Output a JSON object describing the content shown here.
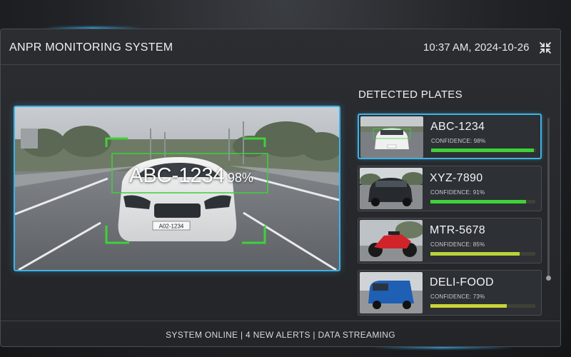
{
  "header": {
    "title": "ANPR MONITORING SYSTEM",
    "datetime": "10:37 AM, 2024-10-26",
    "collapse_icon": "collapse-arrows-icon"
  },
  "feed": {
    "plate": "ABC-1234",
    "confidence": "98%",
    "car_plate_text": "A02-1234"
  },
  "detected": {
    "title": "DETECTED PLATES",
    "items": [
      {
        "plate": "ABC-1234",
        "confidence_label": "CONFIDENCE: 98%",
        "confidence": 0.98,
        "bar_color": "#3fd13a",
        "vehicle": "white-sedan"
      },
      {
        "plate": "XYZ-7890",
        "confidence_label": "CONFIDENCE: 91%",
        "confidence": 0.91,
        "bar_color": "#3fd13a",
        "vehicle": "black-suv"
      },
      {
        "plate": "MTR-5678",
        "confidence_label": "CONFIDENCE: 85%",
        "confidence": 0.85,
        "bar_color": "#b8d23a",
        "vehicle": "red-motorcycle"
      },
      {
        "plate": "DELI-FOOD",
        "confidence_label": "CONFIDENCE: 73%",
        "confidence": 0.73,
        "bar_color": "#c9d33a",
        "vehicle": "blue-van"
      }
    ]
  },
  "footer": {
    "status": "SYSTEM ONLINE  |  4 NEW ALERTS  |  DATA STREAMING"
  },
  "colors": {
    "accent": "#3fb3e6",
    "detection": "#3fd13a"
  }
}
